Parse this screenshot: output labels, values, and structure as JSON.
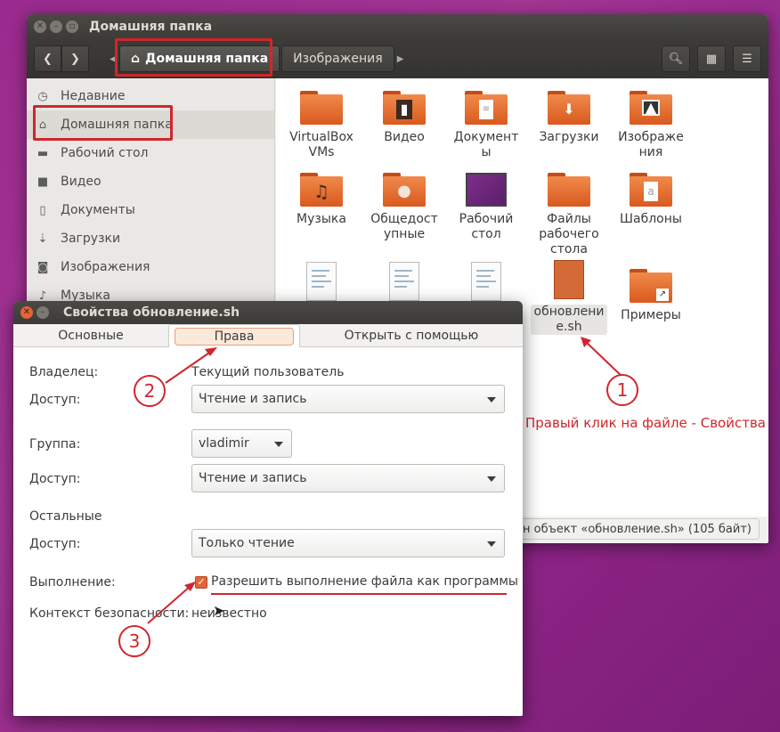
{
  "file_manager": {
    "title": "Домашняя папка",
    "breadcrumbs": [
      "Домашняя папка",
      "Изображения"
    ],
    "sidebar": [
      {
        "label": "Недавние",
        "icon": "clock-icon"
      },
      {
        "label": "Домашняя папка",
        "icon": "home-icon"
      },
      {
        "label": "Рабочий стол",
        "icon": "desktop-folder-icon"
      },
      {
        "label": "Видео",
        "icon": "video-icon"
      },
      {
        "label": "Документы",
        "icon": "document-icon"
      },
      {
        "label": "Загрузки",
        "icon": "download-icon"
      },
      {
        "label": "Изображения",
        "icon": "camera-icon"
      },
      {
        "label": "Музыка",
        "icon": "music-icon"
      }
    ],
    "items": [
      {
        "label": "VirtualBox VMs",
        "line1": "VirtualBox",
        "line2": "VMs"
      },
      {
        "label": "Видео",
        "line1": "Видео",
        "line2": ""
      },
      {
        "label": "Документы",
        "line1": "Документ",
        "line2": "ы"
      },
      {
        "label": "Загрузки",
        "line1": "Загрузки",
        "line2": ""
      },
      {
        "label": "Изображения",
        "line1": "Изображе",
        "line2": "ния"
      },
      {
        "label": "Музыка",
        "line1": "Музыка",
        "line2": ""
      },
      {
        "label": "Общедоступные",
        "line1": "Общедост",
        "line2": "упные"
      },
      {
        "label": "Рабочий стол",
        "line1": "Рабочий",
        "line2": "стол"
      },
      {
        "label": "Файлы рабочего стола",
        "line1": "Файлы",
        "line2": "рабочего",
        "line3": "стола"
      },
      {
        "label": "Шаблоны",
        "line1": "Шаблоны",
        "line2": ""
      },
      {
        "label": "обновление.sh",
        "line1": "обновлени",
        "line2": "е.sh"
      },
      {
        "label": "Примеры",
        "line1": "Примеры",
        "line2": ""
      }
    ],
    "status_text": "н объект «обновление.sh» (105 байт)"
  },
  "annotations": {
    "num1": "1",
    "num2": "2",
    "num3": "3",
    "hint": "Правый клик на файле - Свойства"
  },
  "dialog": {
    "title": "Свойства обновление.sh",
    "tabs": [
      "Основные",
      "Права",
      "Открыть с помощью"
    ],
    "owner_label": "Владелец:",
    "owner_value": "Текущий пользователь",
    "access_label": "Доступ:",
    "owner_access": "Чтение и запись",
    "group_label": "Группа:",
    "group_value": "vladimir",
    "group_access": "Чтение и запись",
    "others_label": "Остальные",
    "others_access": "Только чтение",
    "exec_label": "Выполнение:",
    "exec_checkbox": "Разрешить выполнение файла как программы",
    "exec_checked": true,
    "context_label": "Контекст безопасности:",
    "context_value": "неизвестно"
  },
  "colors": {
    "accent": "#e2643a",
    "annotation_red": "#d0262c",
    "background": "#9a2a8e"
  }
}
